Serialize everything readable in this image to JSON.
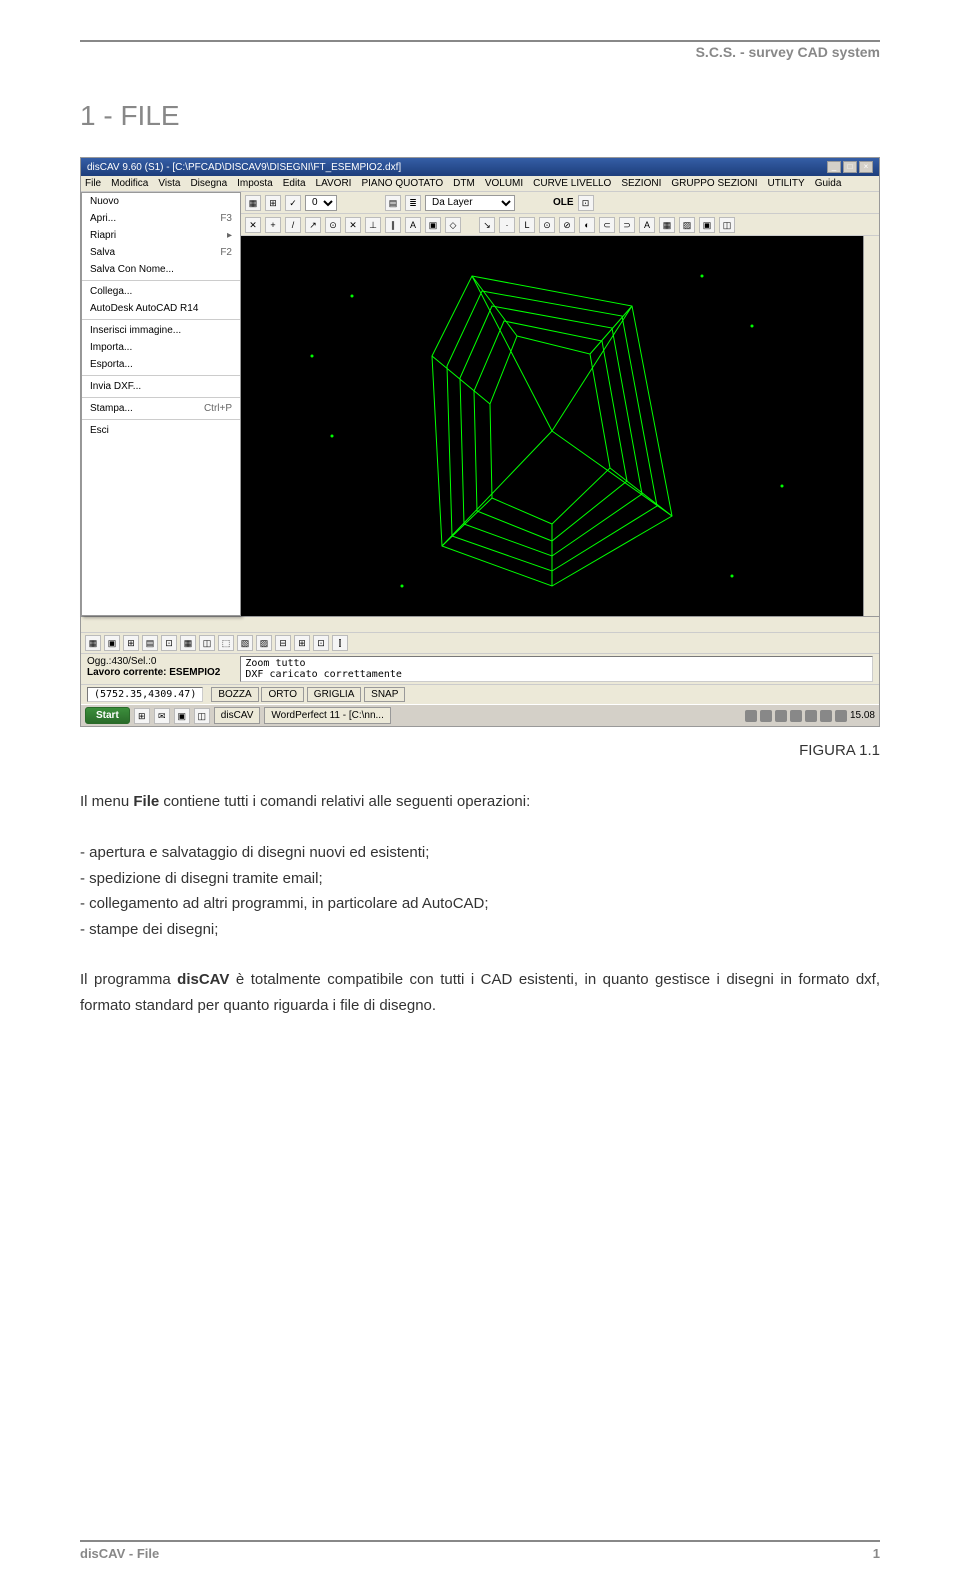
{
  "header": "S.C.S. - survey CAD system",
  "section_title": "1 - FILE",
  "figure_label": "FIGURA 1.1",
  "app": {
    "title": "disCAV 9.60 (S1) - [C:\\PFCAD\\DISCAV9\\DISEGNI\\FT_ESEMPIO2.dxf]",
    "menubar": [
      "File",
      "Modifica",
      "Vista",
      "Disegna",
      "Imposta",
      "Edita",
      "LAVORI",
      "PIANO QUOTATO",
      "DTM",
      "VOLUMI",
      "CURVE LIVELLO",
      "SEZIONI",
      "GRUPPO SEZIONI",
      "UTILITY",
      "Guida"
    ],
    "filemenu": [
      {
        "label": "Nuovo",
        "sc": ""
      },
      {
        "label": "Apri...",
        "sc": "F3"
      },
      {
        "label": "Riapri",
        "sc": "▸"
      },
      {
        "label": "Salva",
        "sc": "F2"
      },
      {
        "label": "Salva Con Nome...",
        "sc": ""
      },
      {
        "sep": true
      },
      {
        "label": "Collega...",
        "sc": ""
      },
      {
        "label": "AutoDesk AutoCAD R14",
        "sc": ""
      },
      {
        "sep": true
      },
      {
        "label": "Inserisci immagine...",
        "sc": ""
      },
      {
        "label": "Importa...",
        "sc": ""
      },
      {
        "label": "Esporta...",
        "sc": ""
      },
      {
        "sep": true
      },
      {
        "label": "Invia DXF...",
        "sc": ""
      },
      {
        "sep": true
      },
      {
        "label": "Stampa...",
        "sc": "Ctrl+P"
      },
      {
        "sep": true
      },
      {
        "label": "Esci",
        "sc": ""
      }
    ],
    "layer_value": "0",
    "dalayer_value": "Da Layer",
    "ole_label": "OLE",
    "status_ogg": "Ogg.:430/Sel.:0",
    "status_lavoro": "Lavoro corrente: ESEMPIO2",
    "status_msg1": "Zoom tutto",
    "status_msg2": "DXF caricato correttamente",
    "coords": "(5752.35,4309.47)",
    "modes": [
      "BOZZA",
      "ORTO",
      "GRIGLIA",
      "SNAP"
    ],
    "taskbar": {
      "start": "Start",
      "apps": [
        "disCAV",
        "WordPerfect 11 - [C:\\nn..."
      ],
      "time": "15.08"
    }
  },
  "para1_intro": "Il menu File contiene tutti i comandi relativi alle seguenti operazioni:",
  "bullets": [
    "apertura e salvataggio di disegni nuovi ed esistenti;",
    "spedizione di disegni tramite email;",
    "collegamento ad altri programmi, in particolare ad AutoCAD;",
    "stampe dei disegni;"
  ],
  "para2_a": "Il programma ",
  "para2_b": "disCAV",
  "para2_c": " è totalmente compatibile con tutti i CAD esistenti, in quanto gestisce i disegni in formato dxf, formato standard per quanto riguarda i file di disegno.",
  "footer_left_a": "disCAV",
  "footer_left_b": " - File",
  "footer_right": "1"
}
